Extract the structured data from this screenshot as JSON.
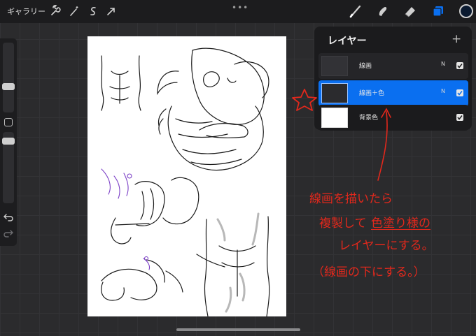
{
  "toolbar": {
    "gallery_label": "ギャラリー",
    "left_tools": [
      "wrench-icon",
      "magic-wand-icon",
      "selection-icon",
      "transform-arrow-icon"
    ],
    "right_tools": [
      "brush-icon",
      "smudge-icon",
      "eraser-icon",
      "layers-icon"
    ],
    "current_color": "#0b1a30"
  },
  "layers_panel": {
    "title": "レイヤー",
    "add_label": "+",
    "layers": [
      {
        "name": "線画",
        "mode": "N",
        "visible": true,
        "active": false
      },
      {
        "name": "線画＋色",
        "mode": "N",
        "visible": true,
        "active": true
      },
      {
        "name": "背景色",
        "mode": "",
        "visible": true,
        "active": false
      }
    ]
  },
  "annotation": {
    "lines": [
      "線画を描いたら",
      "複製して",
      "色塗り様の",
      "レイヤーにする。",
      "（線画の下にする。）"
    ],
    "color": "#e2281c"
  },
  "colors": {
    "accent": "#0a6ff0",
    "annotation": "#e2281c"
  }
}
